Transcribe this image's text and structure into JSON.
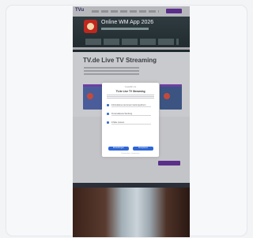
{
  "site": {
    "logo": "TVu",
    "banner_title": "Online WM App 2026",
    "page_title": "TV.de Live TV Streaming"
  },
  "consent": {
    "brand": "tvspielfilm.de",
    "title": "TV.de Live TV Streaming",
    "options": [
      "Informationen auf einem Gerät speichern",
      "Personalisierte Werbung",
      "Inhalte messen"
    ],
    "accept_label": "Einstellungen",
    "reject_label": "Akzeptieren",
    "footer": "Datenschutz · Impressum"
  },
  "colors": {
    "accent": "#5b2e8a",
    "button": "#2f66d6"
  }
}
